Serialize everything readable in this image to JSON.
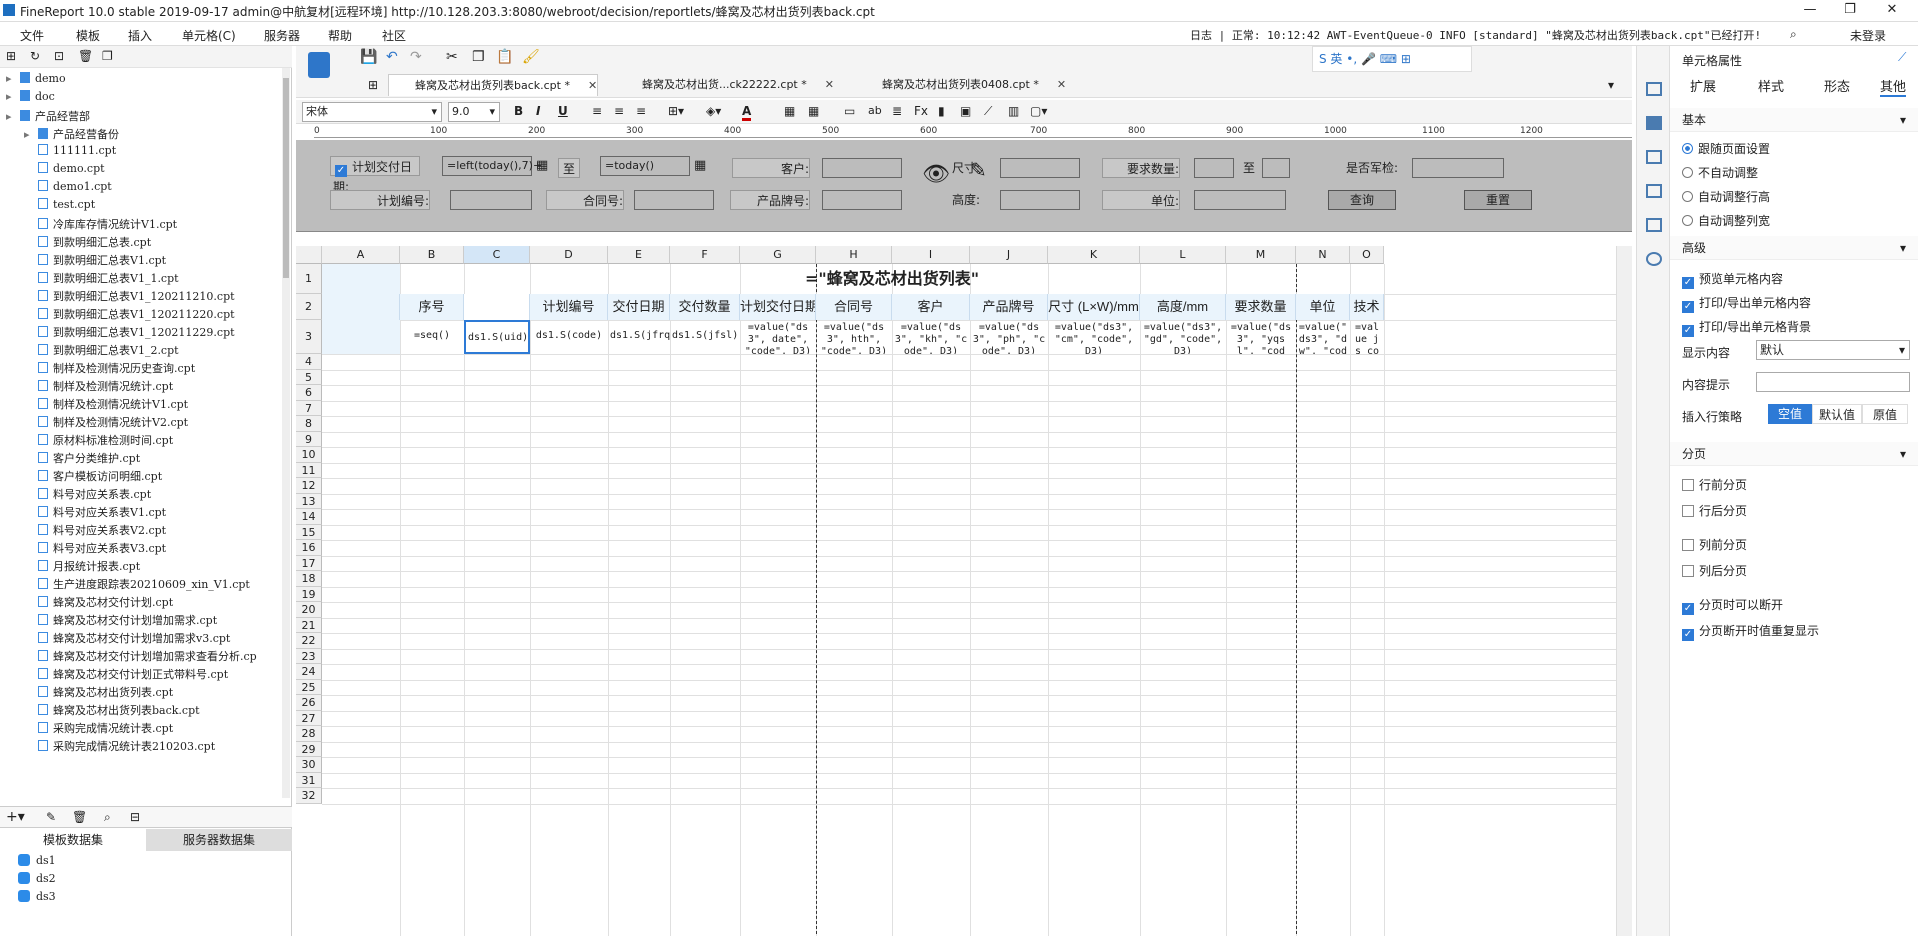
{
  "window": {
    "title": "FineReport 10.0 stable 2019-09-17 admin@中航复材[远程环境]    http://10.128.203.3:8080/webroot/decision/reportlets/蜂窝及芯材出货列表back.cpt",
    "controls": [
      "—",
      "❐",
      "✕"
    ]
  },
  "menu": {
    "items": [
      "文件",
      "模板",
      "插入",
      "单元格(C)",
      "服务器",
      "帮助",
      "社区"
    ],
    "log": "日志 | 正常: 10:12:42 AWT-EventQueue-0 INFO [standard] \"蜂窝及芯材出货列表back.cpt\"已经打开!",
    "login": "未登录"
  },
  "tree": {
    "items": [
      {
        "label": "demo",
        "type": "folder",
        "level": 0
      },
      {
        "label": "doc",
        "type": "folder",
        "level": 0
      },
      {
        "label": "产品经营部",
        "type": "folder",
        "level": 0
      },
      {
        "label": "产品经营备份",
        "type": "folder",
        "level": 1
      },
      {
        "label": "111111.cpt",
        "type": "file",
        "level": 1
      },
      {
        "label": "demo.cpt",
        "type": "file",
        "level": 1
      },
      {
        "label": "demo1.cpt",
        "type": "file",
        "level": 1
      },
      {
        "label": "test.cpt",
        "type": "file",
        "level": 1
      },
      {
        "label": "冷库库存情况统计V1.cpt",
        "type": "file",
        "level": 1
      },
      {
        "label": "到款明细汇总表.cpt",
        "type": "file",
        "level": 1
      },
      {
        "label": "到款明细汇总表V1.cpt",
        "type": "file",
        "level": 1
      },
      {
        "label": "到款明细汇总表V1_1.cpt",
        "type": "file",
        "level": 1
      },
      {
        "label": "到款明细汇总表V1_120211210.cpt",
        "type": "file",
        "level": 1
      },
      {
        "label": "到款明细汇总表V1_120211220.cpt",
        "type": "file",
        "level": 1
      },
      {
        "label": "到款明细汇总表V1_120211229.cpt",
        "type": "file",
        "level": 1
      },
      {
        "label": "到款明细汇总表V1_2.cpt",
        "type": "file",
        "level": 1
      },
      {
        "label": "制样及检测情况历史查询.cpt",
        "type": "file",
        "level": 1
      },
      {
        "label": "制样及检测情况统计.cpt",
        "type": "file",
        "level": 1
      },
      {
        "label": "制样及检测情况统计V1.cpt",
        "type": "file",
        "level": 1
      },
      {
        "label": "制样及检测情况统计V2.cpt",
        "type": "file",
        "level": 1
      },
      {
        "label": "原材料标准检测时间.cpt",
        "type": "file",
        "level": 1
      },
      {
        "label": "客户分类维护.cpt",
        "type": "file",
        "level": 1
      },
      {
        "label": "客户模板访问明细.cpt",
        "type": "file",
        "level": 1
      },
      {
        "label": "料号对应关系表.cpt",
        "type": "file",
        "level": 1
      },
      {
        "label": "料号对应关系表V1.cpt",
        "type": "file",
        "level": 1
      },
      {
        "label": "料号对应关系表V2.cpt",
        "type": "file",
        "level": 1
      },
      {
        "label": "料号对应关系表V3.cpt",
        "type": "file",
        "level": 1
      },
      {
        "label": "月报统计报表.cpt",
        "type": "file",
        "level": 1
      },
      {
        "label": "生产进度跟踪表20210609_xin_V1.cpt",
        "type": "file",
        "level": 1
      },
      {
        "label": "蜂窝及芯材交付计划.cpt",
        "type": "file",
        "level": 1
      },
      {
        "label": "蜂窝及芯材交付计划增加需求.cpt",
        "type": "file",
        "level": 1
      },
      {
        "label": "蜂窝及芯材交付计划增加需求v3.cpt",
        "type": "file",
        "level": 1
      },
      {
        "label": "蜂窝及芯材交付计划增加需求查看分析.cp",
        "type": "file",
        "level": 1
      },
      {
        "label": "蜂窝及芯材交付计划正式带料号.cpt",
        "type": "file",
        "level": 1
      },
      {
        "label": "蜂窝及芯材出货列表.cpt",
        "type": "file",
        "level": 1
      },
      {
        "label": "蜂窝及芯材出货列表back.cpt",
        "type": "file",
        "level": 1
      },
      {
        "label": "采购完成情况统计表.cpt",
        "type": "file",
        "level": 1
      },
      {
        "label": "采购完成情况统计表210203.cpt",
        "type": "file",
        "level": 1
      }
    ]
  },
  "datasets": {
    "tabs": [
      "模板数据集",
      "服务器数据集"
    ],
    "items": [
      "ds1",
      "ds2",
      "ds3"
    ]
  },
  "tabs": [
    {
      "label": "蜂窝及芯材出货列表back.cpt *",
      "active": true
    },
    {
      "label": "蜂窝及芯材出货...ck22222.cpt *",
      "active": false
    },
    {
      "label": "蜂窝及芯材出货列表0408.cpt *",
      "active": false
    }
  ],
  "format": {
    "font": "宋体",
    "size": "9.0",
    "bold": "B",
    "italic": "I",
    "underline": "U"
  },
  "ruler": [
    "0",
    "100",
    "200",
    "300",
    "400",
    "500",
    "600",
    "700",
    "800",
    "900",
    "1000",
    "1100",
    "1200"
  ],
  "params": {
    "check_label": "计划交付日期:",
    "date_from": "=left(today(),7)+",
    "to1": "至",
    "date_to": "=today()",
    "customer": "客户:",
    "size": "尺寸:",
    "req_qty": "要求数量:",
    "to2": "至",
    "is_army": "是否军检:",
    "plan_no": "计划编号:",
    "contract": "合同号:",
    "brand": "产品牌号:",
    "height": "高度:",
    "unit": "单位:",
    "query": "查询",
    "reset": "重置"
  },
  "sheet": {
    "columns": [
      "A",
      "B",
      "C",
      "D",
      "E",
      "F",
      "G",
      "H",
      "I",
      "J",
      "K",
      "L",
      "M",
      "N",
      "O"
    ],
    "title": "=\"蜂窝及芯材出货列表\"",
    "headers": [
      "",
      "序号",
      "",
      "计划编号",
      "交付日期",
      "交付数量",
      "计划交付日期",
      "合同号",
      "客户",
      "产品牌号",
      "尺寸 (L×W)/mm",
      "高度/mm",
      "要求数量",
      "单位",
      "技术"
    ],
    "row3": [
      "",
      "=seq()",
      "ds1.S(uid)",
      "ds1.S(code)",
      "ds1.S(jfrq)",
      "ds1.S(jfsl)",
      "=value(\"ds3\", date\", \"code\", D3)",
      "=value(\"ds3\", hth\", \"code\", D3)",
      "=value(\"ds3\", \"kh\", \"code\", D3)",
      "=value(\"ds3\", \"ph\", \"code\", D3)",
      "=value(\"ds3\", \"cm\", \"code\", D3)",
      "=value(\"ds3\", \"gd\", \"code\", D3)",
      "=value(\"ds3\", \"yqsl\", \"code\", D3)",
      "=value(\" ds3\", \"d w\", \"cod",
      "=value js cod"
    ],
    "row_count": 32
  },
  "side_panel": {
    "title": "单元格属性",
    "tabs": [
      "扩展",
      "样式",
      "形态",
      "其他"
    ],
    "basic": "基本",
    "radios": [
      {
        "label": "跟随页面设置",
        "on": true
      },
      {
        "label": "不自动调整",
        "on": false
      },
      {
        "label": "自动调整行高",
        "on": false
      },
      {
        "label": "自动调整列宽",
        "on": false
      }
    ],
    "advanced": "高级",
    "adv_checks": [
      {
        "label": "预览单元格内容",
        "on": true
      },
      {
        "label": "打印/导出单元格内容",
        "on": true
      },
      {
        "label": "打印/导出单元格背景",
        "on": true
      }
    ],
    "display_label": "显示内容",
    "display_value": "默认",
    "tip_label": "内容提示",
    "insert_label": "插入行策略",
    "insert_opts": [
      "空值",
      "默认值",
      "原值"
    ],
    "paging": "分页",
    "page_checks": [
      {
        "label": "行前分页",
        "on": false
      },
      {
        "label": "行后分页",
        "on": false
      },
      {
        "label": "列前分页",
        "on": false
      },
      {
        "label": "列后分页",
        "on": false
      },
      {
        "label": "分页时可以断开",
        "on": true
      },
      {
        "label": "分页断开时值重复显示",
        "on": true
      }
    ]
  },
  "ime": {
    "label": "S 英 •, 🎤 ⌨ ⊞"
  },
  "colors": {
    "accent": "#2d7ad6",
    "header_bg": "#eaf4fc",
    "param_bg": "#bdbdbd"
  }
}
